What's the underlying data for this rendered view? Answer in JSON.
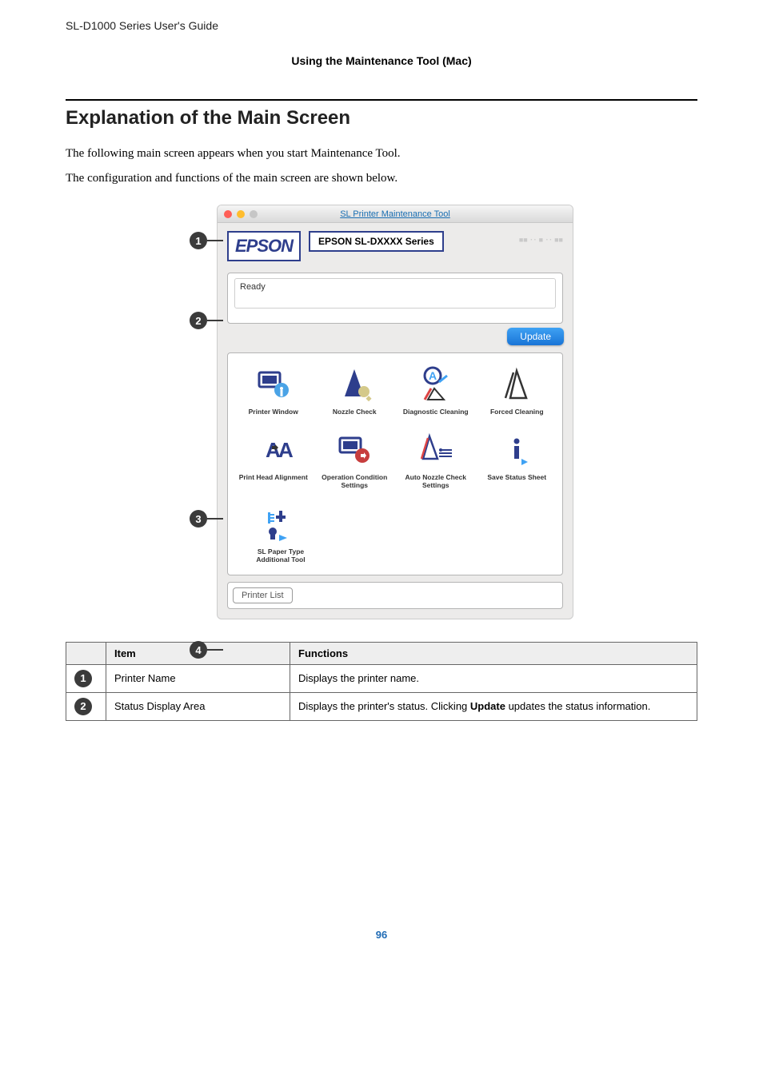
{
  "guideName": "SL-D1000 Series User's Guide",
  "sectionContext": "Using the Maintenance Tool (Mac)",
  "heading": "Explanation of the Main Screen",
  "paragraphs": [
    "The following main screen appears when you start Maintenance Tool.",
    "The configuration and functions of the main screen are shown below."
  ],
  "markers": [
    "1",
    "2",
    "3",
    "4"
  ],
  "window": {
    "title": "SL Printer Maintenance Tool",
    "logo": "EPSON",
    "series": "EPSON SL-DXXXX Series",
    "faded": "■■ ･･ ■ ･･ ■■",
    "status": "Ready",
    "updateBtn": "Update",
    "tilesRow1": [
      {
        "name": "printer-window-tile",
        "label": "Printer Window"
      },
      {
        "name": "nozzle-check-tile",
        "label": "Nozzle Check"
      },
      {
        "name": "diagnostic-cleaning-tile",
        "label": "Diagnostic Cleaning"
      },
      {
        "name": "forced-cleaning-tile",
        "label": "Forced Cleaning"
      }
    ],
    "tilesRow2": [
      {
        "name": "print-head-alignment-tile",
        "label": "Print Head Alignment"
      },
      {
        "name": "operation-condition-settings-tile",
        "label": "Operation Condition Settings"
      },
      {
        "name": "auto-nozzle-check-settings-tile",
        "label": "Auto Nozzle Check Settings"
      },
      {
        "name": "save-status-sheet-tile",
        "label": "Save Status Sheet"
      }
    ],
    "tilesRow3": [
      {
        "name": "sl-paper-type-additional-tool-tile",
        "label": "SL Paper Type Additional Tool"
      }
    ],
    "printerListBtn": "Printer List"
  },
  "table": {
    "headers": {
      "item": "Item",
      "functions": "Functions"
    },
    "rows": [
      {
        "marker": "1",
        "item": "Printer Name",
        "functionPre": "Displays the printer name.",
        "functionBold": "",
        "functionPost": ""
      },
      {
        "marker": "2",
        "item": "Status Display Area",
        "functionPre": "Displays the printer's status. Clicking ",
        "functionBold": "Update",
        "functionPost": " updates the status information."
      }
    ]
  },
  "pageNumber": "96"
}
